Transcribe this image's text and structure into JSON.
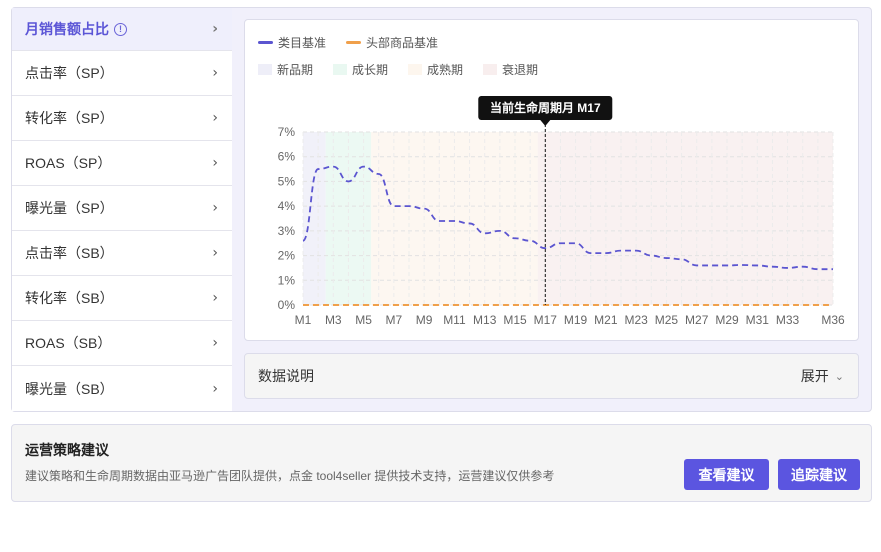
{
  "sidebar": {
    "items": [
      {
        "label": "月销售额占比",
        "active": true,
        "info_icon": "info-circle-icon"
      },
      {
        "label": "点击率（SP）"
      },
      {
        "label": "转化率（SP）"
      },
      {
        "label": "ROAS（SP）"
      },
      {
        "label": "曝光量（SP）"
      },
      {
        "label": "点击率（SB）"
      },
      {
        "label": "转化率（SB）"
      },
      {
        "label": "ROAS（SB）"
      },
      {
        "label": "曝光量（SB）"
      }
    ],
    "chevron_icon": "chevron-right-icon"
  },
  "legend": {
    "series": [
      {
        "label": "类目基准",
        "color": "#5b55d0"
      },
      {
        "label": "头部商品基准",
        "color": "#f0a04b"
      }
    ],
    "phases": [
      {
        "label": "新品期",
        "color": "#eeeef8"
      },
      {
        "label": "成长期",
        "color": "#e9f8f1"
      },
      {
        "label": "成熟期",
        "color": "#fdf6ee"
      },
      {
        "label": "衰退期",
        "color": "#f8eeee"
      }
    ]
  },
  "tooltip": {
    "label": "当前生命周期月 M17"
  },
  "chart_data": {
    "type": "line",
    "x": [
      "M1",
      "M2",
      "M3",
      "M4",
      "M5",
      "M6",
      "M7",
      "M8",
      "M9",
      "M10",
      "M11",
      "M12",
      "M13",
      "M14",
      "M15",
      "M16",
      "M17",
      "M18",
      "M19",
      "M20",
      "M21",
      "M22",
      "M23",
      "M24",
      "M25",
      "M26",
      "M27",
      "M28",
      "M29",
      "M30",
      "M31",
      "M32",
      "M33",
      "M34",
      "M35",
      "M36"
    ],
    "x_tick_labels": [
      "M1",
      "M3",
      "M5",
      "M7",
      "M9",
      "M11",
      "M13",
      "M15",
      "M17",
      "M19",
      "M21",
      "M23",
      "M25",
      "M27",
      "M29",
      "M31",
      "M33",
      "M36"
    ],
    "y_tick_labels": [
      "0%",
      "1%",
      "2%",
      "3%",
      "4%",
      "5%",
      "6%",
      "7%"
    ],
    "ylim": [
      0,
      7
    ],
    "series": [
      {
        "name": "类目基准",
        "color": "#5b55d0",
        "values": [
          2.6,
          5.5,
          5.6,
          5.0,
          5.6,
          5.3,
          4.0,
          4.0,
          3.9,
          3.4,
          3.4,
          3.3,
          2.9,
          3.0,
          2.7,
          2.6,
          2.3,
          2.5,
          2.5,
          2.1,
          2.1,
          2.2,
          2.2,
          2.0,
          1.9,
          1.85,
          1.6,
          1.6,
          1.6,
          1.62,
          1.6,
          1.55,
          1.5,
          1.55,
          1.45,
          1.45
        ]
      },
      {
        "name": "头部商品基准",
        "color": "#f0a04b",
        "values": [
          0,
          0,
          0,
          0,
          0,
          0,
          0,
          0,
          0,
          0,
          0,
          0,
          0,
          0,
          0,
          0,
          0,
          0,
          0,
          0,
          0,
          0,
          0,
          0,
          0,
          0,
          0,
          0,
          0,
          0,
          0,
          0,
          0,
          0,
          0,
          0
        ]
      }
    ],
    "phases": [
      {
        "name": "新品期",
        "from": "M1",
        "to": "M2"
      },
      {
        "name": "成长期",
        "from": "M3",
        "to": "M5"
      },
      {
        "name": "成熟期",
        "from": "M6",
        "to": "M16"
      },
      {
        "name": "衰退期",
        "from": "M17",
        "to": "M36"
      }
    ],
    "marker": "M17",
    "grid": true
  },
  "data_note": {
    "title": "数据说明",
    "expand_label": "展开",
    "expand_icon": "chevron-down-icon"
  },
  "strategy": {
    "title": "运营策略建议",
    "description": "建议策略和生命周期数据由亚马逊广告团队提供，点金 tool4seller 提供技术支持，运营建议仅供参考",
    "view_button": "查看建议",
    "track_button": "追踪建议"
  }
}
